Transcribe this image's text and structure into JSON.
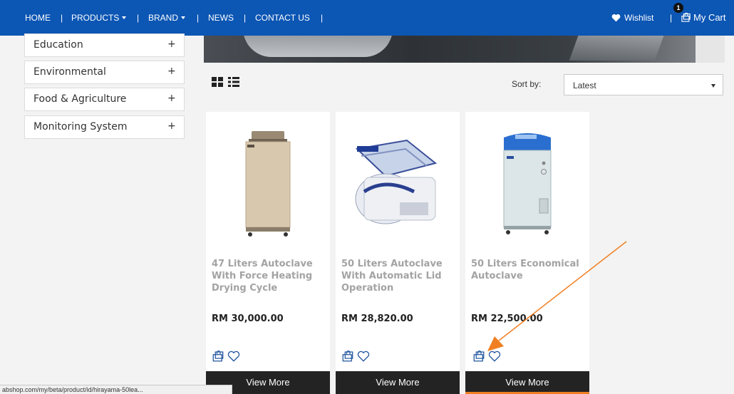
{
  "nav": {
    "home": "HOME",
    "products": "PRODUCTS",
    "brand": "BRAND",
    "news": "NEWS",
    "contact": "CONTACT US",
    "separator": "|",
    "wishlist": "Wishlist",
    "cart": "My Cart",
    "cart_count": "1"
  },
  "sidebar": {
    "categories": [
      {
        "label": "Education",
        "expand": "+"
      },
      {
        "label": "Environmental",
        "expand": "+"
      },
      {
        "label": "Food & Agriculture",
        "expand": "+"
      },
      {
        "label": "Monitoring System",
        "expand": "+"
      }
    ]
  },
  "toolbar": {
    "sort_label": "Sort by:",
    "sort_value": "Latest"
  },
  "products": [
    {
      "name": "47 Liters Autoclave With Force Heating Drying Cycle",
      "price": "RM 30,000.00",
      "button": "View More"
    },
    {
      "name": "50 Liters Autoclave With Automatic Lid Operation",
      "price": "RM 28,820.00",
      "button": "View More"
    },
    {
      "name": "50 Liters Economical Autoclave",
      "price": "RM 22,500.00",
      "button": "View More"
    }
  ],
  "status_url": "abshop.com/my/beta/product/id/hirayama-50lea...",
  "colors": {
    "nav_bg": "#0c56b4",
    "button_bg": "#232323",
    "accent": "#f07f22",
    "product_name": "#a3a3a3"
  },
  "icons": [
    "heart-icon",
    "shopping-bag-icon",
    "grid-view-icon",
    "list-view-icon",
    "plus-icon",
    "chevron-down-icon"
  ]
}
